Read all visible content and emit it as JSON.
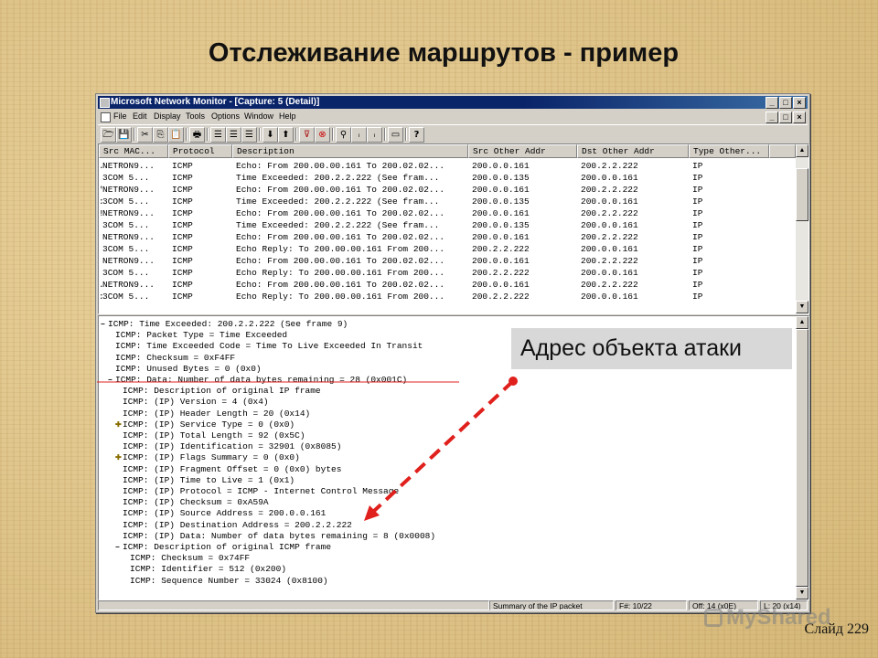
{
  "slide": {
    "title": "Отслеживание маршрутов - пример",
    "slide_number": "Слайд 229",
    "watermark": "MyShared"
  },
  "window": {
    "title": "Microsoft Network Monitor - [Capture: 5 (Detail)]",
    "controls": {
      "minimize": "_",
      "maximize": "□",
      "close": "×"
    }
  },
  "menu": {
    "items": [
      "File",
      "Edit",
      "Display",
      "Tools",
      "Options",
      "Window",
      "Help"
    ]
  },
  "toolbar": {
    "buttons": [
      "open-icon",
      "save-icon",
      "cut-icon",
      "copy-icon",
      "paste-icon",
      "print-icon",
      "pane-layout-icon",
      "pane-layout-2-icon",
      "pane-layout-3-icon",
      "arrow-down-icon",
      "arrow-up-icon",
      "filter-icon",
      "stop-filter-icon",
      "binoculars-icon",
      "find-previous-icon",
      "find-next-icon",
      "window-icon",
      "help-icon"
    ],
    "glyphs": [
      "🗁",
      "💾",
      "✂",
      "⎘",
      "📋",
      "🖶",
      "☰",
      "☰",
      "☰",
      "⬇",
      "⬆",
      "⊽",
      "⊗",
      "⚲",
      "ᵢ",
      "ᵢ",
      "▭",
      "?"
    ]
  },
  "packet_list": {
    "columns": [
      "Src MAC...",
      "Protocol",
      "Description",
      "Src Other Addr",
      "Dst Other Addr",
      "Type Other..."
    ],
    "rows": [
      {
        "mark": ".",
        "src_mac": "NETRON9...",
        "protocol": "ICMP",
        "description": "Echo: From 200.00.00.161 To 200.02.02...",
        "src_addr": "200.0.0.161",
        "dst_addr": "200.2.2.222",
        "type": "IP"
      },
      {
        "mark": "",
        "src_mac": "3COM  5...",
        "protocol": "ICMP",
        "description": "Time Exceeded: 200.2.2.222  (See fram...",
        "src_addr": "200.0.0.135",
        "dst_addr": "200.0.0.161",
        "type": "IP"
      },
      {
        "mark": "'",
        "src_mac": "NETRON9...",
        "protocol": "ICMP",
        "description": "Echo: From 200.00.00.161 To 200.02.02...",
        "src_addr": "200.0.0.161",
        "dst_addr": "200.2.2.222",
        "type": "IP"
      },
      {
        "mark": ":",
        "src_mac": "3COM  5...",
        "protocol": "ICMP",
        "description": "Time Exceeded: 200.2.2.222  (See fram...",
        "src_addr": "200.0.0.135",
        "dst_addr": "200.0.0.161",
        "type": "IP"
      },
      {
        "mark": "!",
        "src_mac": "NETRON9...",
        "protocol": "ICMP",
        "description": "Echo: From 200.00.00.161 To 200.02.02...",
        "src_addr": "200.0.0.161",
        "dst_addr": "200.2.2.222",
        "type": "IP"
      },
      {
        "mark": "",
        "src_mac": "3COM  5...",
        "protocol": "ICMP",
        "description": "Time Exceeded: 200.2.2.222  (See fram...",
        "src_addr": "200.0.0.135",
        "dst_addr": "200.0.0.161",
        "type": "IP"
      },
      {
        "mark": "",
        "src_mac": "NETRON9...",
        "protocol": "ICMP",
        "description": "Echo: From 200.00.00.161 To 200.02.02...",
        "src_addr": "200.0.0.161",
        "dst_addr": "200.2.2.222",
        "type": "IP"
      },
      {
        "mark": "",
        "src_mac": "3COM  5...",
        "protocol": "ICMP",
        "description": "Echo Reply: To 200.00.00.161 From 200...",
        "src_addr": "200.2.2.222",
        "dst_addr": "200.0.0.161",
        "type": "IP"
      },
      {
        "mark": "",
        "src_mac": "NETRON9...",
        "protocol": "ICMP",
        "description": "Echo: From 200.00.00.161 To 200.02.02...",
        "src_addr": "200.0.0.161",
        "dst_addr": "200.2.2.222",
        "type": "IP"
      },
      {
        "mark": "",
        "src_mac": "3COM  5...",
        "protocol": "ICMP",
        "description": "Echo Reply: To 200.00.00.161 From 200...",
        "src_addr": "200.2.2.222",
        "dst_addr": "200.0.0.161",
        "type": "IP"
      },
      {
        "mark": ".",
        "src_mac": "NETRON9...",
        "protocol": "ICMP",
        "description": "Echo: From 200.00.00.161 To 200.02.02...",
        "src_addr": "200.0.0.161",
        "dst_addr": "200.2.2.222",
        "type": "IP"
      },
      {
        "mark": ":",
        "src_mac": "3COM  5...",
        "protocol": "ICMP",
        "description": "Echo Reply: To 200.00.00.161 From 200...",
        "src_addr": "200.2.2.222",
        "dst_addr": "200.0.0.161",
        "type": "IP"
      }
    ]
  },
  "detail": {
    "lines": [
      {
        "level": 0,
        "tree": "minus",
        "text": "ICMP: Time Exceeded: 200.2.2.222  (See frame 9)"
      },
      {
        "level": 1,
        "tree": "",
        "text": "ICMP: Packet Type = Time Exceeded"
      },
      {
        "level": 1,
        "tree": "",
        "text": "ICMP: Time Exceeded Code = Time To Live Exceeded In Transit"
      },
      {
        "level": 1,
        "tree": "",
        "text": "ICMP: Checksum = 0xF4FF"
      },
      {
        "level": 1,
        "tree": "",
        "text": "ICMP: Unused Bytes = 0 (0x0)"
      },
      {
        "level": 1,
        "tree": "minus",
        "text": "ICMP: Data: Number of data bytes remaining = 28 (0x001C)"
      },
      {
        "level": 2,
        "tree": "",
        "text": "ICMP: Description of original IP frame"
      },
      {
        "level": 2,
        "tree": "",
        "text": "ICMP: (IP) Version = 4 (0x4)"
      },
      {
        "level": 2,
        "tree": "",
        "text": "ICMP: (IP) Header Length = 20 (0x14)"
      },
      {
        "level": 2,
        "tree": "plus",
        "text": "ICMP: (IP) Service Type = 0 (0x0)"
      },
      {
        "level": 2,
        "tree": "",
        "text": "ICMP: (IP) Total Length = 92 (0x5C)"
      },
      {
        "level": 2,
        "tree": "",
        "text": "ICMP: (IP) Identification = 32901 (0x8085)"
      },
      {
        "level": 2,
        "tree": "plus",
        "text": "ICMP: (IP) Flags Summary = 0 (0x0)"
      },
      {
        "level": 2,
        "tree": "",
        "text": "ICMP: (IP) Fragment Offset = 0 (0x0) bytes"
      },
      {
        "level": 2,
        "tree": "",
        "text": "ICMP: (IP) Time to Live = 1 (0x1)"
      },
      {
        "level": 2,
        "tree": "",
        "text": "ICMP: (IP) Protocol = ICMP - Internet Control Message"
      },
      {
        "level": 2,
        "tree": "",
        "text": "ICMP: (IP) Checksum = 0xA59A"
      },
      {
        "level": 2,
        "tree": "",
        "text": "ICMP: (IP) Source Address = 200.0.0.161"
      },
      {
        "level": 2,
        "tree": "",
        "text": "ICMP: (IP) Destination Address = 200.2.2.222"
      },
      {
        "level": 2,
        "tree": "",
        "text": "ICMP: (IP) Data: Number of data bytes remaining = 8 (0x0008)"
      },
      {
        "level": 2,
        "tree": "minus",
        "text": "ICMP: Description of original ICMP frame"
      },
      {
        "level": 3,
        "tree": "",
        "text": "ICMP: Checksum = 0x74FF"
      },
      {
        "level": 3,
        "tree": "",
        "text": "ICMP: Identifier = 512 (0x200)"
      },
      {
        "level": 3,
        "tree": "",
        "text": "ICMP: Sequence Number = 33024 (0x8100)"
      }
    ]
  },
  "status": {
    "summary": "Summary of the IP packet",
    "frame": "F#: 10/22",
    "offset": "Off: 14 (x0E)",
    "length": "L: 20 (x14)"
  },
  "callout": {
    "text": "Адрес объекта атаки",
    "arrow_color": "#e0201c"
  }
}
